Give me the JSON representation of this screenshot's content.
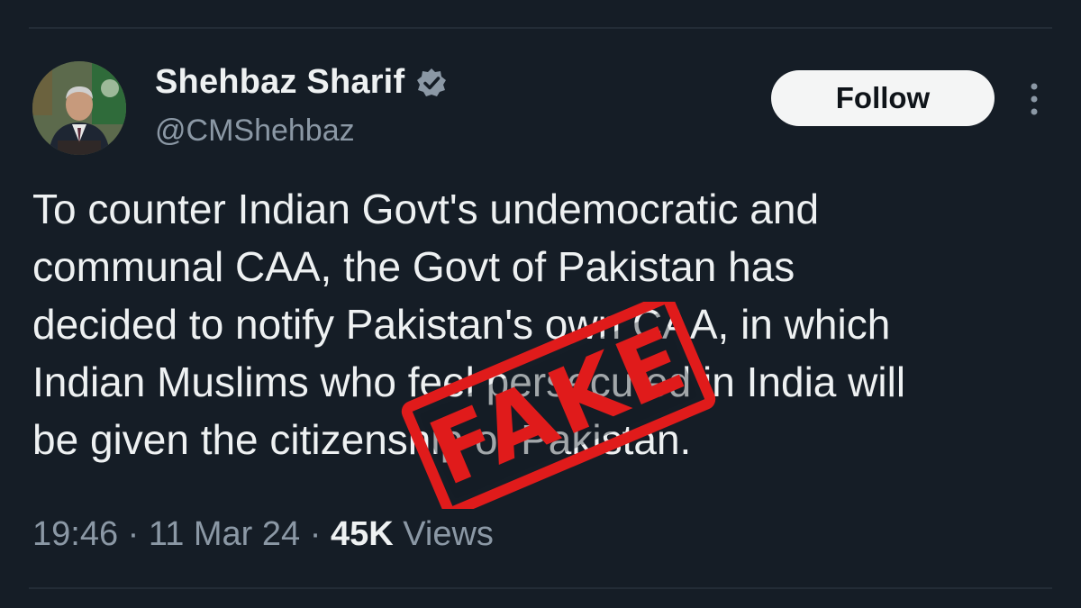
{
  "author": {
    "name": "Shehbaz Sharif",
    "handle": "@CMShehbaz",
    "verified_icon": "verified-badge-icon"
  },
  "follow_button": {
    "label": "Follow"
  },
  "tweet": {
    "lines": [
      "To counter Indian Govt's undemocratic and",
      "communal CAA, the Govt of Pakistan has",
      "decided to notify Pakistan's own CAA, in which",
      "Indian Muslims who feel persecuted in India will",
      "be given the citizenship of Pakistan."
    ]
  },
  "meta": {
    "time": "19:46",
    "separator": "·",
    "date": "11 Mar 24",
    "views_count": "45K",
    "views_label": "Views"
  },
  "stamp": {
    "text": "FAKE"
  },
  "colors": {
    "background": "#151d26",
    "text_primary": "#eef1f2",
    "text_secondary": "#8b98a5",
    "verified_blue": "#1d9bf0",
    "stamp_red": "#e01b1b"
  }
}
